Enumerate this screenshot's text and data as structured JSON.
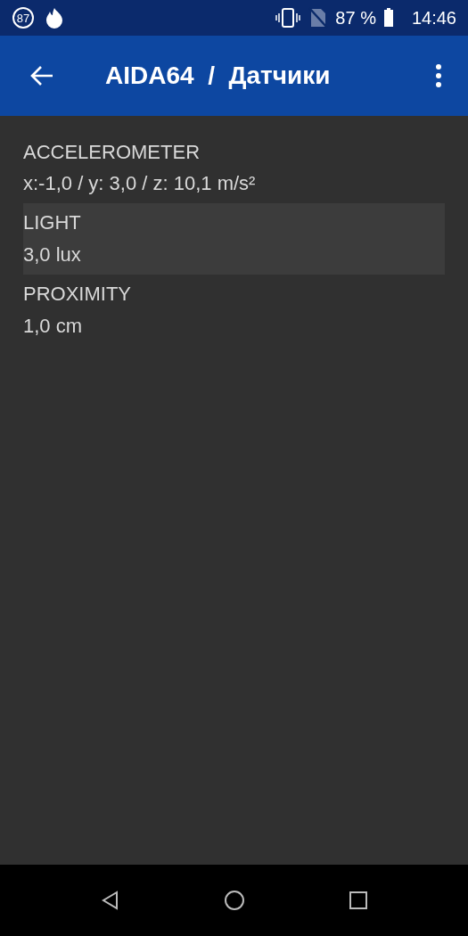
{
  "status_bar": {
    "badge": "87",
    "battery": "87 %",
    "time": "14:46"
  },
  "app_bar": {
    "title": "AIDA64  /  Датчики"
  },
  "sensors": [
    {
      "name": "ACCELEROMETER",
      "value": "x:-1,0 / y: 3,0 / z: 10,1 m/s²",
      "selected": false
    },
    {
      "name": "LIGHT",
      "value": "3,0 lux",
      "selected": true
    },
    {
      "name": "PROXIMITY",
      "value": "1,0 cm",
      "selected": false
    }
  ]
}
